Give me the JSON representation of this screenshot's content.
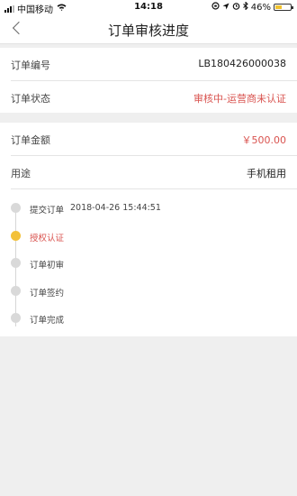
{
  "status_bar": {
    "carrier": "中国移动",
    "time": "14:18",
    "battery_text": "46%",
    "battery_level": 0.46,
    "battery_color": "#f2c22e"
  },
  "nav": {
    "title": "订单审核进度",
    "back_icon": "chevron-left-icon"
  },
  "order": {
    "number_label": "订单编号",
    "number_value": "LB180426000038",
    "status_label": "订单状态",
    "status_value": "审核中-运营商未认证",
    "amount_label": "订单金额",
    "amount_value": "￥500.00",
    "purpose_label": "用途",
    "purpose_value": "手机租用"
  },
  "timeline": {
    "steps": [
      {
        "label": "提交订单",
        "time": "2018-04-26 15:44:51",
        "active": false
      },
      {
        "label": "授权认证",
        "time": "",
        "active": true
      },
      {
        "label": "订单初审",
        "time": "",
        "active": false
      },
      {
        "label": "订单签约",
        "time": "",
        "active": false
      },
      {
        "label": "订单完成",
        "time": "",
        "active": false
      }
    ],
    "active_color": "#f3c13a",
    "inactive_color": "#d9d9d9",
    "highlight_text_color": "#d9534f"
  }
}
